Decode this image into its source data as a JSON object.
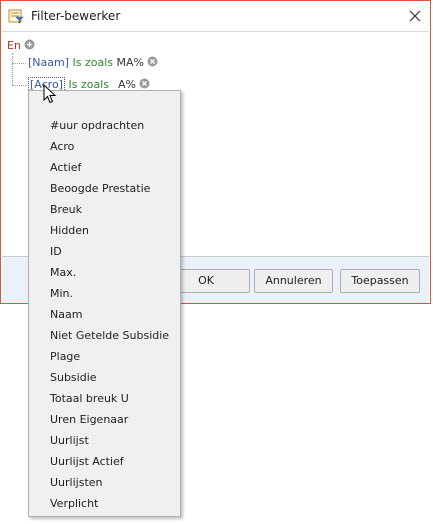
{
  "window": {
    "title": "Filter-bewerker",
    "app_icon": "filter-editor-icon",
    "close_icon": "close-icon",
    "accent_color": "#e0523c"
  },
  "tree": {
    "group_label": "En",
    "conditions": [
      {
        "field": "[Naam]",
        "operator": "Is zoals",
        "value": "MA%"
      },
      {
        "field": "[Acro]",
        "operator": "Is zoals",
        "value": "_A%"
      }
    ]
  },
  "footer": {
    "ok_label": "OK",
    "cancel_label": "Annuleren",
    "apply_label": "Toepassen"
  },
  "dropdown": {
    "items": [
      "#uur opdrachten",
      "Acro",
      "Actief",
      "Beoogde Prestatie",
      "Breuk",
      "Hidden",
      "ID",
      "Max.",
      "Min.",
      "Naam",
      "Niet Getelde Subsidie",
      "Plage",
      "Subsidie",
      "Totaal breuk U",
      "Uren Eigenaar",
      "Uurlijst",
      "Uurlijst Actief",
      "Uurlijsten",
      "Verplicht"
    ]
  }
}
